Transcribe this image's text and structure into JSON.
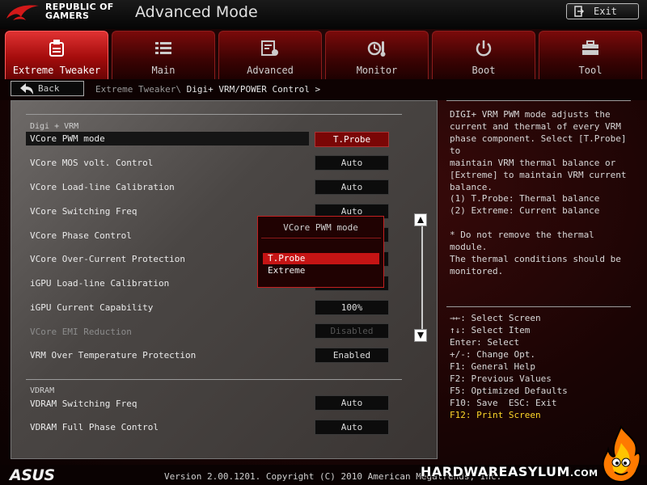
{
  "header": {
    "brand_line1": "REPUBLIC OF",
    "brand_line2": "GAMERS",
    "mode_title": "Advanced Mode",
    "exit_label": "Exit"
  },
  "tabs": [
    {
      "label": "Extreme Tweaker",
      "icon": "tweaker-icon",
      "active": true
    },
    {
      "label": "Main",
      "icon": "list-icon"
    },
    {
      "label": "Advanced",
      "icon": "advanced-icon"
    },
    {
      "label": "Monitor",
      "icon": "monitor-icon"
    },
    {
      "label": "Boot",
      "icon": "power-icon"
    },
    {
      "label": "Tool",
      "icon": "toolbox-icon"
    }
  ],
  "nav": {
    "back_label": "Back",
    "breadcrumb_parent": "Extreme Tweaker\\",
    "breadcrumb_current": "Digi+ VRM/POWER Control >"
  },
  "settings": {
    "section1_title": "Digi + VRM",
    "section2_title": "VDRAM",
    "rows": [
      {
        "label": "VCore PWM mode",
        "value": "T.Probe"
      },
      {
        "label": "VCore MOS volt. Control",
        "value": "Auto"
      },
      {
        "label": "VCore Load-line Calibration",
        "value": "Auto"
      },
      {
        "label": "VCore Switching Freq",
        "value": "Auto"
      },
      {
        "label": "VCore Phase Control",
        "value": ""
      },
      {
        "label": "VCore Over-Current Protection",
        "value": ""
      },
      {
        "label": "iGPU Load-line Calibration",
        "value": ""
      },
      {
        "label": "iGPU Current Capability",
        "value": "100%"
      },
      {
        "label": "VCore EMI Reduction",
        "value": "Disabled",
        "disabled": true
      },
      {
        "label": "VRM Over Temperature Protection",
        "value": "Enabled"
      },
      {
        "label": "VDRAM Switching Freq",
        "value": "Auto"
      },
      {
        "label": "VDRAM Full Phase Control",
        "value": "Auto"
      }
    ]
  },
  "popup": {
    "title": "VCore PWM mode",
    "options": [
      "T.Probe",
      "Extreme"
    ],
    "selected": "T.Probe"
  },
  "help": {
    "description": "DIGI+ VRM PWM mode adjusts the\ncurrent and thermal of every VRM\nphase component. Select [T.Probe] to\nmaintain VRM thermal balance or\n[Extreme] to maintain VRM current\nbalance.",
    "options_text": "(1) T.Probe: Thermal balance\n(2) Extreme: Current balance",
    "note": "* Do not remove the thermal module.\nThe thermal conditions should be\nmonitored.",
    "keys": [
      "→←: Select Screen",
      "↑↓: Select Item",
      "Enter: Select",
      "+/-: Change Opt.",
      "F1: General Help",
      "F2: Previous Values",
      "F5: Optimized Defaults",
      "F10: Save  ESC: Exit",
      "F12: Print Screen"
    ],
    "highlight_color": "#ffd82a"
  },
  "footer": {
    "logo": "ASUS",
    "version": "Version 2.00.1201. Copyright (C) 2010 American Megatrends, Inc.",
    "watermark_main": "HARDWAREASYLUM",
    "watermark_suffix": ".COM"
  },
  "colors": {
    "accent": "#c51414",
    "tab_active": "#d42424",
    "selected_value_bg": "#7a0606"
  }
}
